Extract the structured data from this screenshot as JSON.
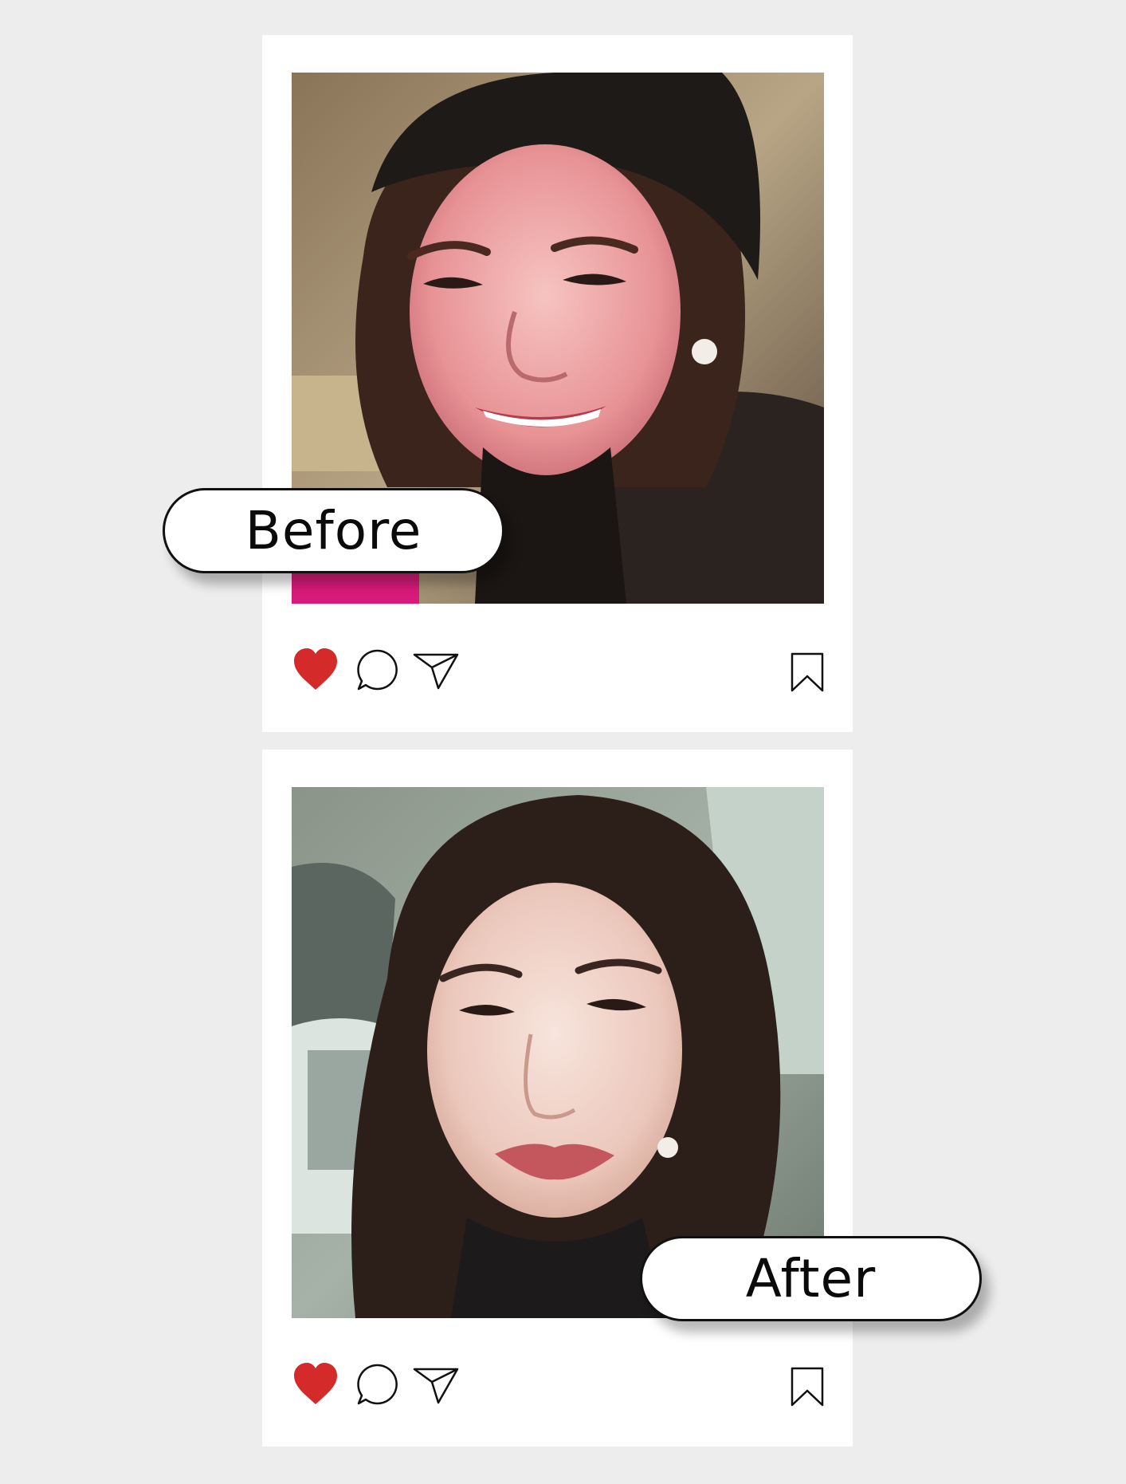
{
  "posts": [
    {
      "label": "Before",
      "photo_alt": "before-photo",
      "icons": [
        "heart-icon",
        "comment-icon",
        "send-icon",
        "bookmark-icon"
      ]
    },
    {
      "label": "After",
      "photo_alt": "after-photo",
      "icons": [
        "heart-icon",
        "comment-icon",
        "send-icon",
        "bookmark-icon"
      ]
    }
  ],
  "colors": {
    "background": "#ededed",
    "card": "#ffffff",
    "like": "#d42a2a",
    "outline": "#111111"
  }
}
